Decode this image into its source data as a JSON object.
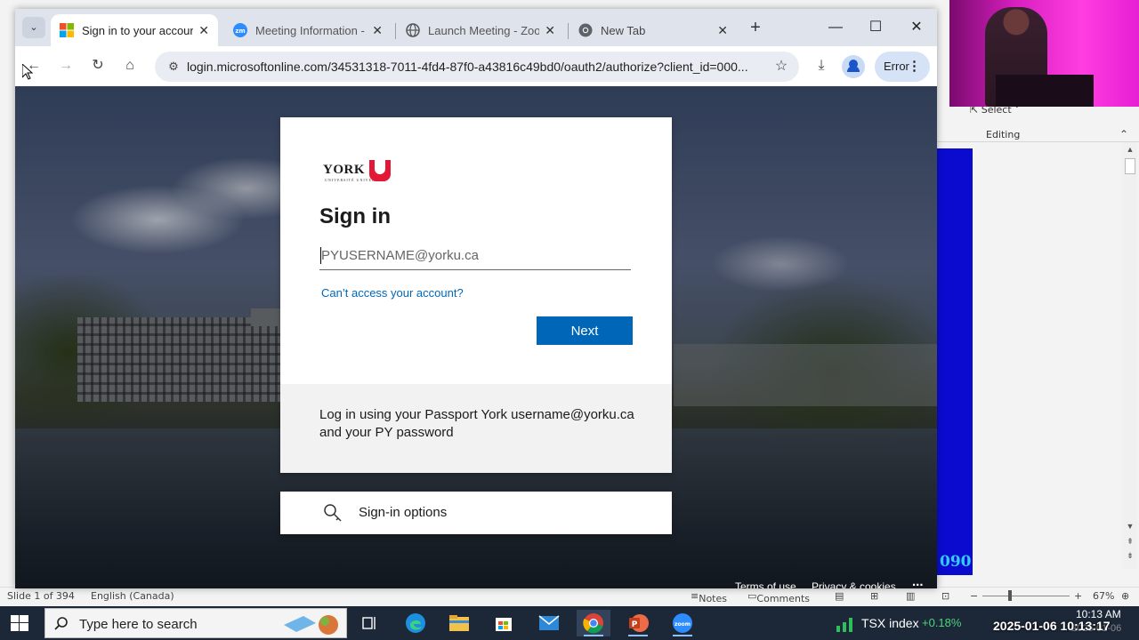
{
  "browser": {
    "tabs": [
      {
        "title": "Sign in to your account",
        "active": true,
        "icon": "microsoft-icon"
      },
      {
        "title": "Meeting Information -",
        "active": false,
        "icon": "zoom-icon"
      },
      {
        "title": "Launch Meeting - Zoom",
        "active": false,
        "icon": "globe-icon"
      },
      {
        "title": "New Tab",
        "active": false,
        "icon": "chrome-icon"
      }
    ],
    "url": "login.microsoftonline.com/34531318-7011-4fd4-87f0-a43816c49bd0/oauth2/authorize?client_id=000...",
    "error_chip": "Error"
  },
  "signin": {
    "org_logo": "YORK",
    "org_logo_sub": "UNIVERSITÉ  UNIVERSITY",
    "title": "Sign in",
    "email_placeholder": "PYUSERNAME@yorku.ca",
    "cant_access": "Can’t access your account?",
    "next_label": "Next",
    "footer_note": "Log in using your Passport York username@yorku.ca and your PY password",
    "options_label": "Sign-in options",
    "terms": "Terms of use",
    "privacy": "Privacy & cookies",
    "more": "..."
  },
  "powerpoint": {
    "select_label": "Select",
    "editing_label": "Editing",
    "slide_counter": "Slide 1 of 394",
    "language": "English (Canada)",
    "notes_label": "Notes",
    "comments_label": "Comments",
    "zoom": "67%",
    "slide_number_text": "090",
    "colors": {
      "slide_blue": "#0b0bd0",
      "slide_number": "#33ccff"
    }
  },
  "taskbar": {
    "search_placeholder": "Type here to search",
    "tsx_label": "TSX index",
    "tsx_change": "+0.18%",
    "clock_time": "10:13 AM",
    "clock_date": "2025-01-06",
    "timestamp": "2025-01-06 10:13:17",
    "apps": [
      "task-view-icon",
      "edge-icon",
      "file-explorer-icon",
      "store-icon",
      "mail-icon",
      "chrome-icon",
      "powerpoint-icon",
      "zoom-icon"
    ]
  },
  "colors": {
    "accent": "#0067b8",
    "brand_red": "#e31837",
    "taskbar": "#1c2838"
  }
}
